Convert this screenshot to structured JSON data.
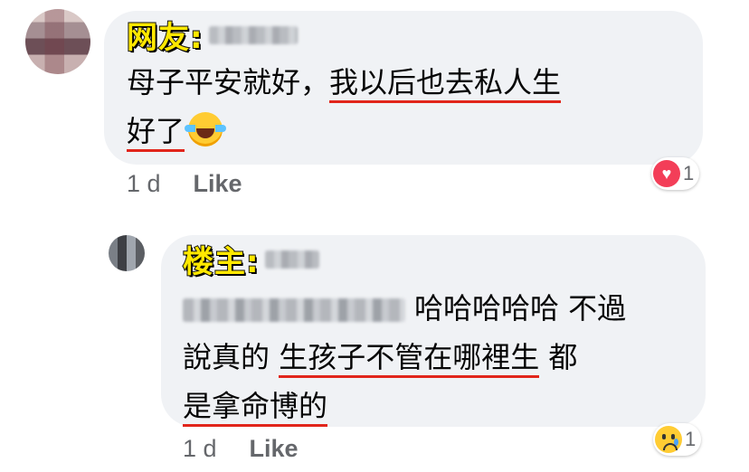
{
  "comments": [
    {
      "author_tag": "网友:",
      "text_lines": [
        {
          "plain": "母子平安就好，",
          "underlined": "我以后也去私人生"
        },
        {
          "plain": "",
          "underlined": "好了"
        }
      ],
      "emoji": "laughing-with-tears",
      "time": "1 d",
      "like_label": "Like",
      "reaction": {
        "icon": "heart-icon",
        "count": "1",
        "color": "#f33e58"
      }
    },
    {
      "author_tag": "楼主:",
      "line1_text": "哈哈哈哈哈 不過",
      "line2_plain": "說真的 ",
      "line2_underlined": "生孩子不管在哪裡生",
      "line2_tail": " 都",
      "line3_underlined": "是拿命博的",
      "time": "1 d",
      "like_label": "Like",
      "reaction": {
        "icon": "sad-icon",
        "count": "1",
        "color": "#ffcc33"
      }
    }
  ],
  "colors": {
    "bubble": "#f0f2f5",
    "tag_fill": "#ffe800",
    "underline": "#e1251b",
    "meta": "#65676b"
  }
}
